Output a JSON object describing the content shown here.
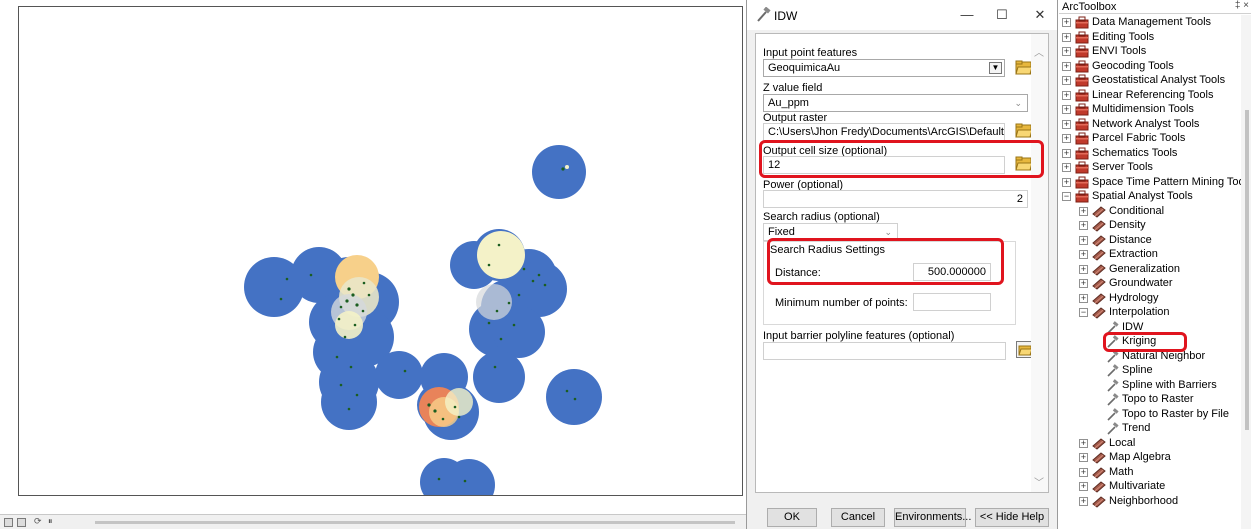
{
  "dialog": {
    "title": "IDW",
    "buttons": {
      "minimize": "—",
      "maximize": "☐",
      "close": "✕"
    },
    "fields": {
      "input_point_features": {
        "label": "Input point features",
        "value": "GeoquimicaAu"
      },
      "z_value_field": {
        "label": "Z value field",
        "value": "Au_ppm"
      },
      "output_raster": {
        "label": "Output raster",
        "value": "C:\\Users\\Jhon Fredy\\Documents\\ArcGIS\\Default.gdb\\Idw_sl"
      },
      "output_cell_size": {
        "label": "Output cell size (optional)",
        "value": "12"
      },
      "power": {
        "label": "Power (optional)",
        "value": "2"
      },
      "search_radius": {
        "label": "Search radius (optional)",
        "value": "Fixed"
      },
      "search_radius_settings": {
        "title": "Search Radius Settings",
        "distance_label": "Distance:",
        "distance_value": "500.000000",
        "min_points_label": "Minimum number of points:",
        "min_points_value": ""
      },
      "barrier": {
        "label": "Input barrier polyline features (optional)",
        "value": ""
      }
    },
    "actions": {
      "ok": "OK",
      "cancel": "Cancel",
      "environments": "Environments...",
      "hide_help": "<< Hide Help"
    }
  },
  "toolbox": {
    "title": "ArcToolbox",
    "pin": "‡ ×",
    "items": [
      {
        "label": "Data Management Tools",
        "level": 0,
        "exp": "+",
        "icon": "toolbox"
      },
      {
        "label": "Editing Tools",
        "level": 0,
        "exp": "+",
        "icon": "toolbox"
      },
      {
        "label": "ENVI Tools",
        "level": 0,
        "exp": "+",
        "icon": "toolbox"
      },
      {
        "label": "Geocoding Tools",
        "level": 0,
        "exp": "+",
        "icon": "toolbox"
      },
      {
        "label": "Geostatistical Analyst Tools",
        "level": 0,
        "exp": "+",
        "icon": "toolbox"
      },
      {
        "label": "Linear Referencing Tools",
        "level": 0,
        "exp": "+",
        "icon": "toolbox"
      },
      {
        "label": "Multidimension Tools",
        "level": 0,
        "exp": "+",
        "icon": "toolbox"
      },
      {
        "label": "Network Analyst Tools",
        "level": 0,
        "exp": "+",
        "icon": "toolbox"
      },
      {
        "label": "Parcel Fabric Tools",
        "level": 0,
        "exp": "+",
        "icon": "toolbox"
      },
      {
        "label": "Schematics Tools",
        "level": 0,
        "exp": "+",
        "icon": "toolbox"
      },
      {
        "label": "Server Tools",
        "level": 0,
        "exp": "+",
        "icon": "toolbox"
      },
      {
        "label": "Space Time Pattern Mining Tools",
        "level": 0,
        "exp": "+",
        "icon": "toolbox"
      },
      {
        "label": "Spatial Analyst Tools",
        "level": 0,
        "exp": "-",
        "icon": "toolbox"
      },
      {
        "label": "Conditional",
        "level": 1,
        "exp": "+",
        "icon": "toolset"
      },
      {
        "label": "Density",
        "level": 1,
        "exp": "+",
        "icon": "toolset"
      },
      {
        "label": "Distance",
        "level": 1,
        "exp": "+",
        "icon": "toolset"
      },
      {
        "label": "Extraction",
        "level": 1,
        "exp": "+",
        "icon": "toolset"
      },
      {
        "label": "Generalization",
        "level": 1,
        "exp": "+",
        "icon": "toolset"
      },
      {
        "label": "Groundwater",
        "level": 1,
        "exp": "+",
        "icon": "toolset"
      },
      {
        "label": "Hydrology",
        "level": 1,
        "exp": "+",
        "icon": "toolset"
      },
      {
        "label": "Interpolation",
        "level": 1,
        "exp": "-",
        "icon": "toolset"
      },
      {
        "label": "IDW",
        "level": 2,
        "exp": "",
        "icon": "tool"
      },
      {
        "label": "Kriging",
        "level": 2,
        "exp": "",
        "icon": "tool"
      },
      {
        "label": "Natural Neighbor",
        "level": 2,
        "exp": "",
        "icon": "tool"
      },
      {
        "label": "Spline",
        "level": 2,
        "exp": "",
        "icon": "tool"
      },
      {
        "label": "Spline with Barriers",
        "level": 2,
        "exp": "",
        "icon": "tool"
      },
      {
        "label": "Topo to Raster",
        "level": 2,
        "exp": "",
        "icon": "tool"
      },
      {
        "label": "Topo to Raster by File",
        "level": 2,
        "exp": "",
        "icon": "tool"
      },
      {
        "label": "Trend",
        "level": 2,
        "exp": "",
        "icon": "tool"
      },
      {
        "label": "Local",
        "level": 1,
        "exp": "+",
        "icon": "toolset"
      },
      {
        "label": "Map Algebra",
        "level": 1,
        "exp": "+",
        "icon": "toolset"
      },
      {
        "label": "Math",
        "level": 1,
        "exp": "+",
        "icon": "toolset"
      },
      {
        "label": "Multivariate",
        "level": 1,
        "exp": "+",
        "icon": "toolset"
      },
      {
        "label": "Neighborhood",
        "level": 1,
        "exp": "+",
        "icon": "toolset"
      }
    ]
  },
  "colors": {
    "buffer_fill": "#4472c4",
    "point": "#1b5e20",
    "highlight": "#e0141e",
    "idw_low": "#f4f2c8",
    "idw_mid": "#f7d08a",
    "idw_high": "#e8835a"
  },
  "icons": {
    "tool": "hammer-icon",
    "toolbox": "red-toolbox-icon",
    "toolset": "toolset-icon",
    "browse": "folder-open-icon"
  }
}
